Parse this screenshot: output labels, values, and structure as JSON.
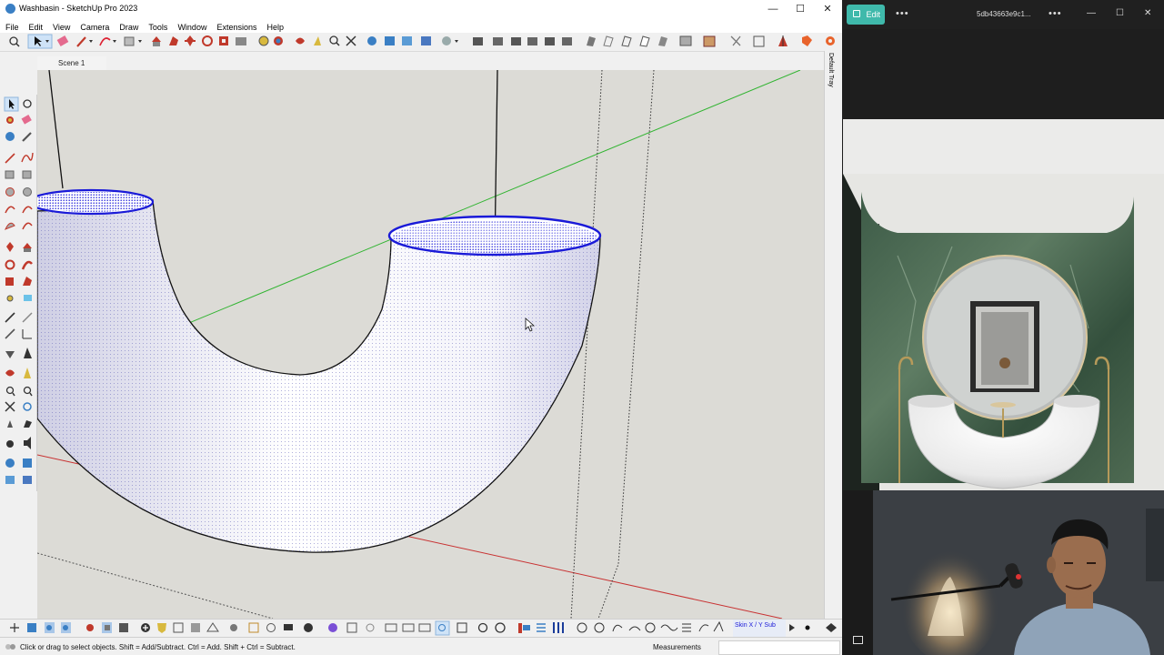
{
  "window": {
    "title": "Washbasin - SketchUp Pro 2023",
    "minimize": "—",
    "maximize": "☐",
    "close": "✕"
  },
  "menu": [
    "File",
    "Edit",
    "View",
    "Camera",
    "Draw",
    "Tools",
    "Window",
    "Extensions",
    "Help"
  ],
  "scene_tab": "Scene 1",
  "right_tray_label": "Default Tray",
  "bottom_toolbar": {
    "plugin_label": "Skin X / Y Sub"
  },
  "status": {
    "hint": "Click or drag to select objects. Shift = Add/Subtract. Ctrl = Add. Shift + Ctrl = Subtract.",
    "measurements_label": "Measurements",
    "measurements_value": ""
  },
  "viewer": {
    "edit_label": "Edit",
    "more": "•••",
    "file_name": "5db43663e9c1...",
    "more2": "•••",
    "minimize": "—",
    "maximize": "☐",
    "close": "✕"
  },
  "colors": {
    "model_edge": "#1a1ad8",
    "axis_green": "#32b432",
    "axis_red": "#c83232",
    "edit_button": "#3fb9ab",
    "viewport_bg": "#dcdbd6"
  }
}
